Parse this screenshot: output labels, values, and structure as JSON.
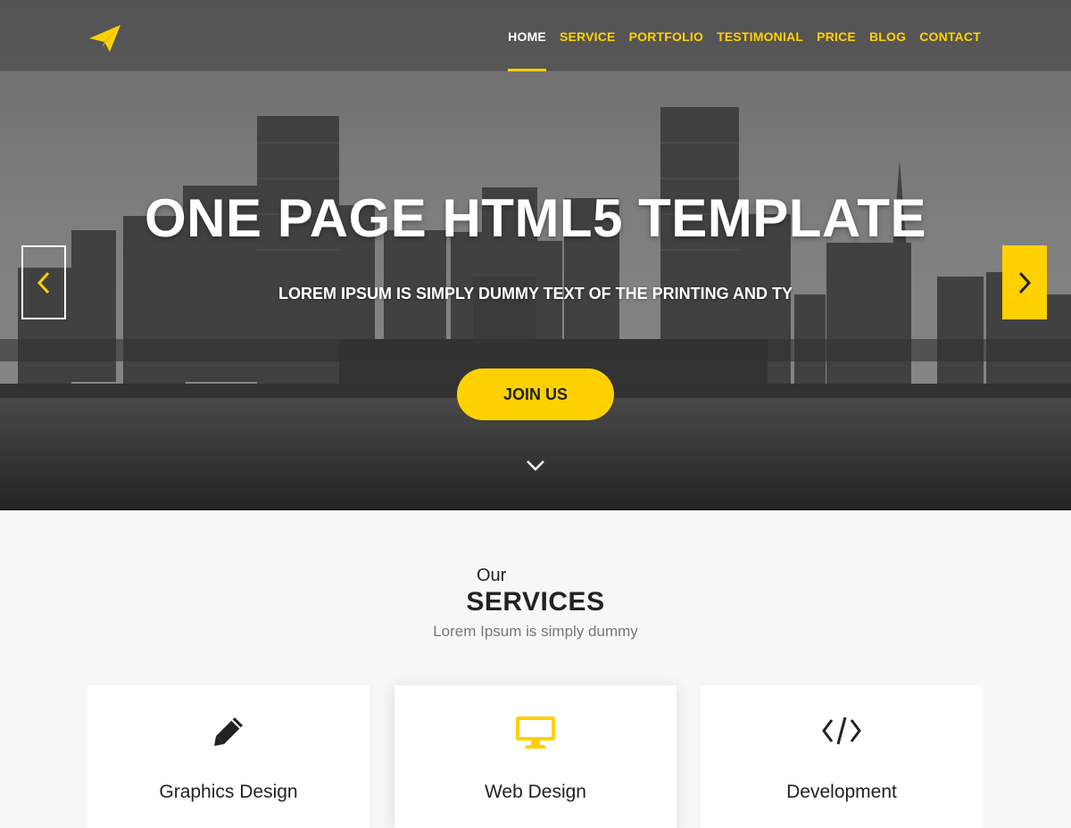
{
  "nav": {
    "items": [
      {
        "label": "HOME",
        "active": true
      },
      {
        "label": "SERVICE",
        "active": false
      },
      {
        "label": "PORTFOLIO",
        "active": false
      },
      {
        "label": "TESTIMONIAL",
        "active": false
      },
      {
        "label": "PRICE",
        "active": false
      },
      {
        "label": "BLOG",
        "active": false
      },
      {
        "label": "CONTACT",
        "active": false
      }
    ]
  },
  "hero": {
    "title": "ONE PAGE HTML5 TEMPLATE",
    "subtitle": "LOREM IPSUM IS SIMPLY DUMMY TEXT OF THE PRINTING AND TY",
    "cta_label": "JOIN US"
  },
  "services": {
    "eyebrow": "Our",
    "title": "SERVICES",
    "subtitle": "Lorem Ipsum is simply dummy",
    "cards": [
      {
        "title": "Graphics Design",
        "icon": "pencil-icon"
      },
      {
        "title": "Web Design",
        "icon": "monitor-icon"
      },
      {
        "title": "Development",
        "icon": "code-icon"
      }
    ]
  },
  "colors": {
    "accent": "#ffd100",
    "text": "#222222",
    "muted": "#777777",
    "background": "#f7f7f7"
  }
}
